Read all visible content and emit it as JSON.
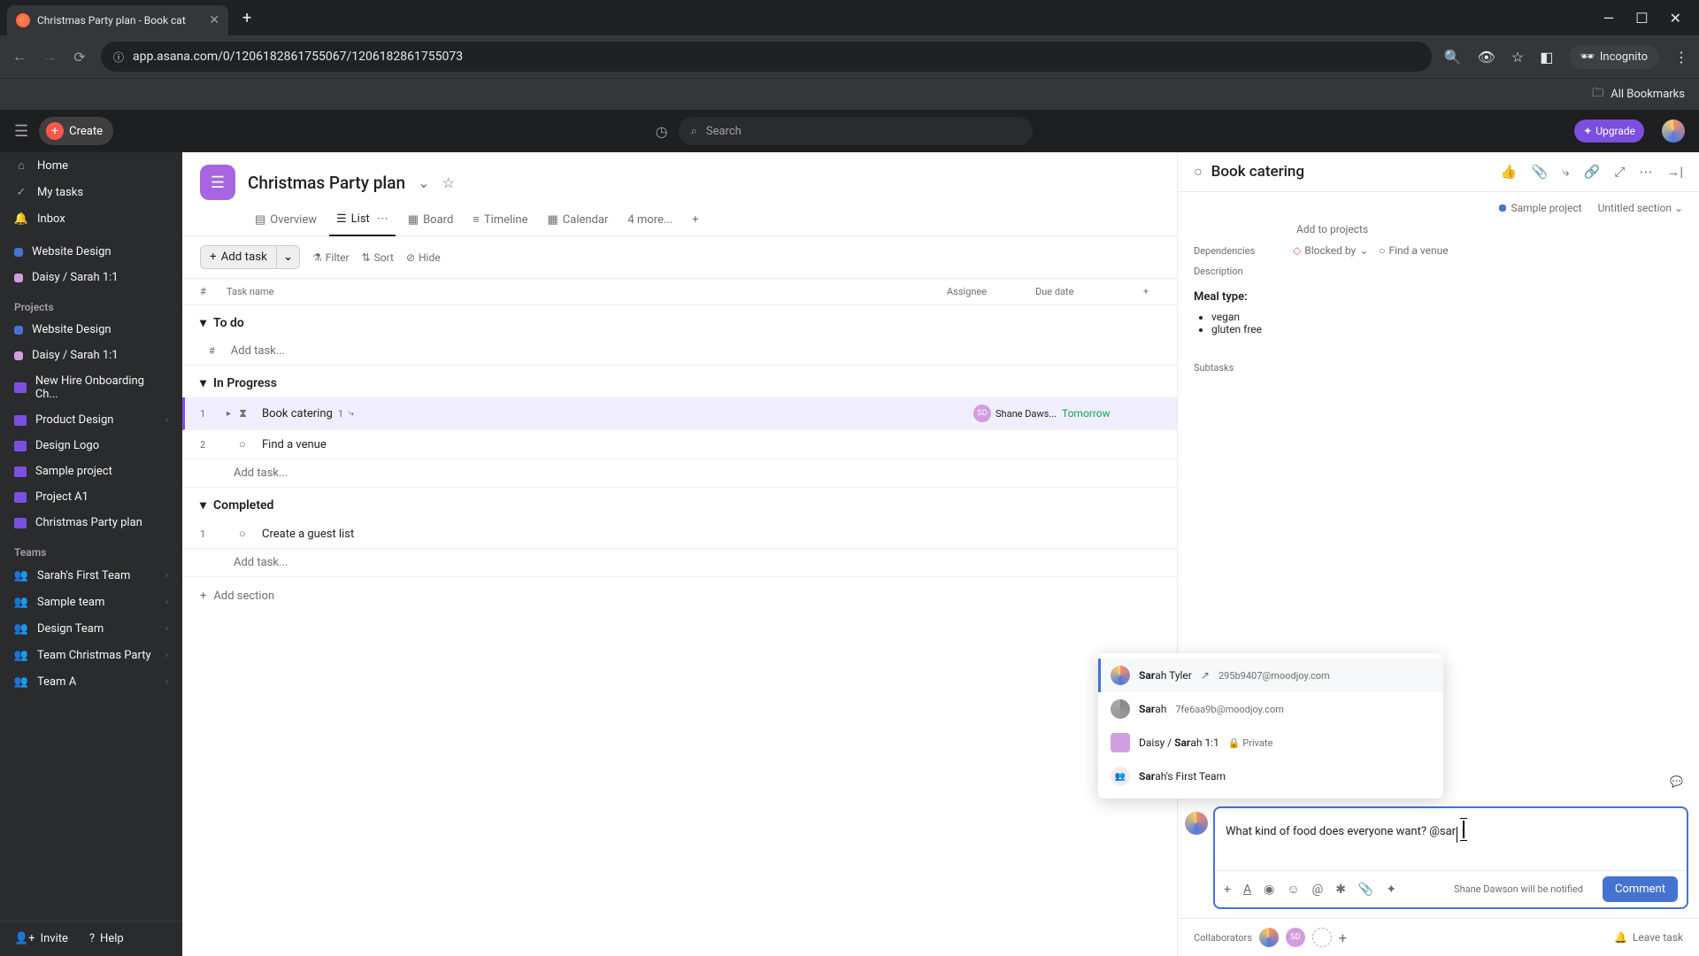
{
  "browser": {
    "tab_title": "Christmas Party plan - Book cat",
    "url": "app.asana.com/0/1206182861755067/1206182861755073",
    "incognito_label": "Incognito",
    "all_bookmarks": "All Bookmarks"
  },
  "topbar": {
    "create": "Create",
    "search_placeholder": "Search",
    "upgrade": "Upgrade"
  },
  "sidebar": {
    "nav": [
      {
        "label": "Home",
        "icon": "home"
      },
      {
        "label": "My tasks",
        "icon": "check"
      },
      {
        "label": "Inbox",
        "icon": "bell"
      }
    ],
    "recent": [
      {
        "label": "Website Design",
        "color": "#4573d2"
      },
      {
        "label": "Daisy / Sarah 1:1",
        "color": "#d19de0"
      }
    ],
    "projects_header": "Projects",
    "projects": [
      {
        "label": "Website Design",
        "color": "#4573d2"
      },
      {
        "label": "Daisy / Sarah 1:1",
        "color": "#d19de0"
      },
      {
        "label": "New Hire Onboarding Ch...",
        "folder": true
      },
      {
        "label": "Product Design",
        "folder": true
      },
      {
        "label": "Design Logo",
        "folder": true
      },
      {
        "label": "Sample project",
        "folder": true
      },
      {
        "label": "Project A1",
        "folder": true
      },
      {
        "label": "Christmas Party plan",
        "folder": true
      }
    ],
    "teams_header": "Teams",
    "teams": [
      {
        "label": "Sarah's First Team"
      },
      {
        "label": "Sample team"
      },
      {
        "label": "Design Team"
      },
      {
        "label": "Team Christmas Party"
      },
      {
        "label": "Team A"
      }
    ],
    "invite": "Invite",
    "help": "Help"
  },
  "project": {
    "title": "Christmas Party plan",
    "tabs": {
      "overview": "Overview",
      "list": "List",
      "board": "Board",
      "timeline": "Timeline",
      "calendar": "Calendar",
      "more": "4 more..."
    },
    "toolbar": {
      "add_task": "Add task",
      "filter": "Filter",
      "sort": "Sort",
      "hide": "Hide"
    },
    "columns": {
      "num": "#",
      "task_name": "Task name",
      "assignee": "Assignee",
      "due_date": "Due date"
    },
    "sections": {
      "todo": {
        "title": "To do",
        "add_task": "Add task..."
      },
      "inprogress": {
        "title": "In Progress",
        "tasks": [
          {
            "num": "1",
            "name": "Book catering",
            "subtask_count": "1",
            "assignee": "Shane Daws...",
            "due": "Tomorrow",
            "due_color": "#12a454"
          },
          {
            "num": "2",
            "name": "Find a venue",
            "assignee": "",
            "due": ""
          }
        ],
        "add_task": "Add task..."
      },
      "completed": {
        "title": "Completed",
        "tasks": [
          {
            "num": "1",
            "name": "Create a guest list"
          }
        ],
        "add_task": "Add task..."
      }
    },
    "add_section": "Add section"
  },
  "detail": {
    "title": "Book catering",
    "project_chip": "Sample project",
    "section_chip": "Untitled section",
    "add_to_projects": "Add to projects",
    "dependencies_label": "Dependencies",
    "blocked_by": "Blocked by",
    "dependency_task": "Find a venue",
    "description_label": "Description",
    "meal_type": "Meal type",
    "bullets": [
      "vegan",
      "gluten free"
    ],
    "subtasks_label": "Subtasks"
  },
  "mention": {
    "items": [
      {
        "name_match": "Sar",
        "name_rest": "ah Tyler",
        "email": "295b9407@moodjoy.com",
        "guest": true,
        "av_bg": "conic-gradient(#ff8c66,#4f7be0,#ffd166)"
      },
      {
        "name_match": "Sar",
        "name_rest": "ah",
        "email": "7fe6aa9b@moodjoy.com",
        "av_bg": "conic-gradient(#888,#aaa)"
      },
      {
        "name_prefix": "Daisy / ",
        "name_match": "Sar",
        "name_rest": "ah 1:1",
        "badge": "Private",
        "av_bg": "#d19de0",
        "square": true
      },
      {
        "name_match": "Sar",
        "name_rest": "ah's First Team",
        "team": true
      }
    ]
  },
  "comment": {
    "text": "What kind of food does everyone want? @sar",
    "notify": "Shane Dawson will be notified",
    "button": "Comment",
    "collaborators_label": "Collaborators",
    "leave_task": "Leave task"
  }
}
